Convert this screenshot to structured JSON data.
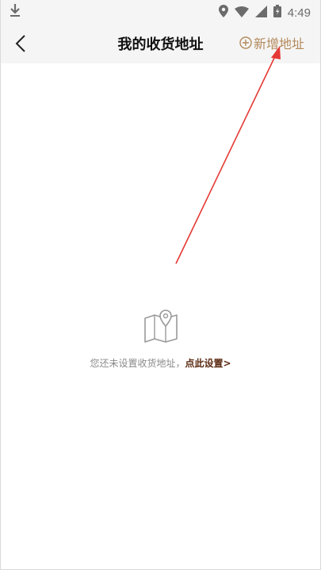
{
  "statusbar": {
    "time": "4:49",
    "icons": [
      "download-icon",
      "location-icon",
      "wifi-icon",
      "signal-icon",
      "battery-icon"
    ]
  },
  "header": {
    "title": "我的收货地址",
    "add_label": "新增地址",
    "back_icon": "chevron-left-icon",
    "add_icon": "plus-circle-icon"
  },
  "empty_state": {
    "icon": "map-pin-icon",
    "message": "您还未设置收货地址，",
    "link_label": "点此设置>"
  },
  "colors": {
    "accent": "#b48a5c",
    "link": "#5b2a12",
    "header_bg": "#f5f5f5",
    "annotation": "#e53935"
  }
}
